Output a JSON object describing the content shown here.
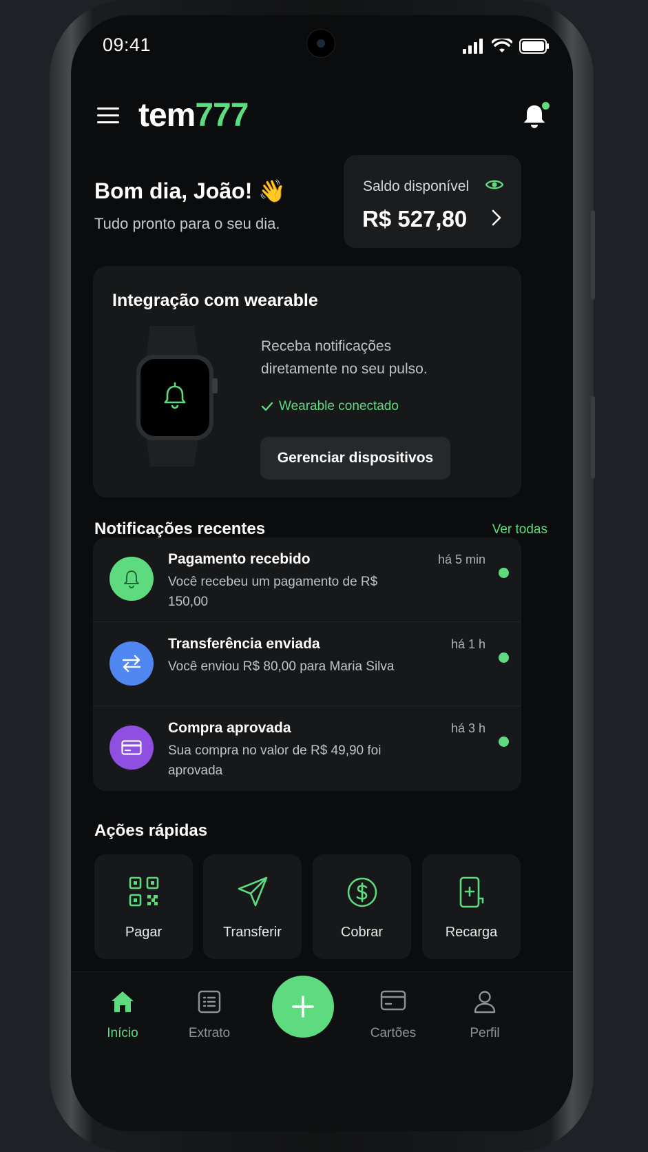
{
  "status_bar": {
    "time": "09:41"
  },
  "app": {
    "logo_main": "tem",
    "logo_accent": "777"
  },
  "greeting": {
    "title": "Bom dia, João! 👋",
    "subtitle": "Tudo pronto para o seu dia."
  },
  "balance": {
    "label": "Saldo disponível",
    "value": "R$ 527,80"
  },
  "wearable": {
    "title": "Integração com wearable",
    "description": "Receba notificações diretamente no seu pulso.",
    "status": "Wearable conectado",
    "button": "Gerenciar dispositivos"
  },
  "notifications": {
    "title": "Notificações recentes",
    "see_all": "Ver todas",
    "items": [
      {
        "title": "Pagamento recebido",
        "text": "Você recebeu um pagamento de R$ 150,00",
        "time": "há 5 min",
        "icon": "bell-icon",
        "color": "#5fdb7f"
      },
      {
        "title": "Transferência enviada",
        "text": "Você enviou R$ 80,00 para Maria Silva",
        "time": "há 1 h",
        "icon": "transfer-icon",
        "color": "#4f86f0"
      },
      {
        "title": "Compra aprovada",
        "text": "Sua compra no valor de R$ 49,90 foi aprovada",
        "time": "há 3 h",
        "icon": "card-icon",
        "color": "#8f4fe0"
      }
    ]
  },
  "quick_actions": {
    "title": "Ações rápidas",
    "items": [
      {
        "label": "Pagar",
        "icon": "qr-code-icon"
      },
      {
        "label": "Transferir",
        "icon": "send-icon"
      },
      {
        "label": "Cobrar",
        "icon": "dollar-circle-icon"
      },
      {
        "label": "Recarga",
        "icon": "phone-recharge-icon"
      }
    ]
  },
  "tab_bar": {
    "items": [
      {
        "label": "Início",
        "icon": "home-icon",
        "active": true
      },
      {
        "label": "Extrato",
        "icon": "statement-icon",
        "active": false
      },
      {
        "label": "Cartões",
        "icon": "card-icon",
        "active": false
      },
      {
        "label": "Perfil",
        "icon": "user-icon",
        "active": false
      }
    ],
    "fab_icon": "plus-icon"
  },
  "colors": {
    "accent": "#5fdb7f",
    "background": "#0b0c0d",
    "card": "#161819"
  }
}
